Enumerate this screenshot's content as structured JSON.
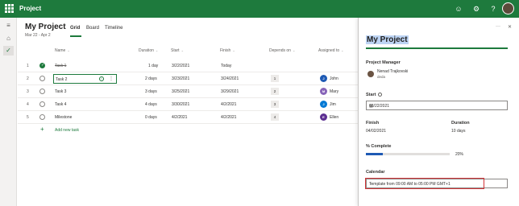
{
  "topbar": {
    "app_title": "Project"
  },
  "project": {
    "title": "My Project",
    "dates": "Mar 22 - Apr 2"
  },
  "tabs": [
    {
      "label": "Grid"
    },
    {
      "label": "Board"
    },
    {
      "label": "Timeline"
    }
  ],
  "columns": {
    "name": "Name",
    "duration": "Duration",
    "start": "Start",
    "finish": "Finish",
    "depends_on": "Depends on",
    "assigned_to": "Assigned to"
  },
  "tasks": [
    {
      "num": "1",
      "name": "Task 1",
      "duration": "1 day",
      "start": "3/22/2021",
      "finish": "Today",
      "depends": "",
      "assignee": "",
      "initial": "",
      "done": true
    },
    {
      "num": "2",
      "name": "Task 2",
      "duration": "2 days",
      "start": "3/23/2021",
      "finish": "3/24/2021",
      "depends": "1",
      "assignee": "John",
      "initial": "J",
      "done": false
    },
    {
      "num": "3",
      "name": "Task 3",
      "duration": "3 days",
      "start": "3/25/2021",
      "finish": "3/29/2021",
      "depends": "2",
      "assignee": "Mary",
      "initial": "M",
      "done": false
    },
    {
      "num": "4",
      "name": "Task 4",
      "duration": "4 days",
      "start": "3/30/2021",
      "finish": "4/2/2021",
      "depends": "3",
      "assignee": "Jim",
      "initial": "J",
      "done": false
    },
    {
      "num": "5",
      "name": "Milestone",
      "duration": "0 days",
      "start": "4/2/2021",
      "finish": "4/2/2021",
      "depends": "4",
      "assignee": "Ellen",
      "initial": "E",
      "done": false
    }
  ],
  "add_task_label": "Add new task",
  "panel": {
    "title": "My Project",
    "pm_label": "Project Manager",
    "pm_name": "Nenad Trajkovski",
    "pm_sub": "deda",
    "start_label": "Start",
    "start_value": "03/22/2021",
    "finish_label": "Finish",
    "finish_value": "04/02/2021",
    "duration_label": "Duration",
    "duration_value": "10 days",
    "complete_label": "% Complete",
    "complete_value": "20%",
    "complete_fraction": 0.2,
    "calendar_label": "Calendar",
    "calendar_value": "Template from 09:00 AM to 05:00 PM GMT+1"
  },
  "colors": {
    "brand": "#1e7a3d",
    "assignee_john": "#1e5ab4",
    "assignee_mary": "#8764b8",
    "assignee_jim": "#0078d4",
    "assignee_ellen": "#5c2e91",
    "highlight": "#d13438"
  }
}
